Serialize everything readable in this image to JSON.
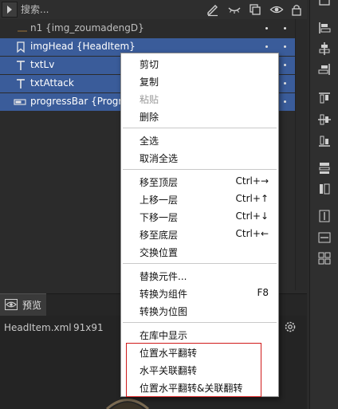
{
  "toolbar": {
    "search_placeholder": "搜索..."
  },
  "tree": {
    "rows": [
      {
        "label": "n1 {img_zoumadengD}",
        "selected": false,
        "icon": "link-line-icon"
      },
      {
        "label": "imgHead {HeadItem}",
        "selected": true,
        "icon": "bookmark-icon"
      },
      {
        "label": "txtLv",
        "selected": true,
        "icon": "text-icon"
      },
      {
        "label": "txtAttack",
        "selected": true,
        "icon": "text-icon"
      },
      {
        "label": "progressBar {Progre",
        "selected": true,
        "icon": "progressbar-icon"
      }
    ]
  },
  "preview": {
    "tab_label": "预览",
    "file_name": "HeadItem.xml",
    "file_size": "91x91"
  },
  "context_menu": {
    "cut": "剪切",
    "copy": "复制",
    "paste": "粘贴",
    "delete": "删除",
    "select_all": "全选",
    "deselect_all": "取消全选",
    "move_top": "移至顶层",
    "move_top_key": "Ctrl+→",
    "move_up": "上移一层",
    "move_up_key": "Ctrl+↑",
    "move_down": "下移一层",
    "move_down_key": "Ctrl+↓",
    "move_bottom": "移至底层",
    "move_bottom_key": "Ctrl+←",
    "swap": "交换位置",
    "replace": "替换元件...",
    "to_component": "转换为组件",
    "to_component_key": "F8",
    "to_bitmap": "转换为位图",
    "show_in_library": "在库中显示",
    "flip_h": "位置水平翻转",
    "flip_h_linked": "水平关联翻转",
    "flip_h_both": "位置水平翻转&关联翻转"
  },
  "colors": {
    "selection": "#3a5c9a",
    "highlight_box": "#d01a1a",
    "menu_bg": "#ffffff"
  }
}
